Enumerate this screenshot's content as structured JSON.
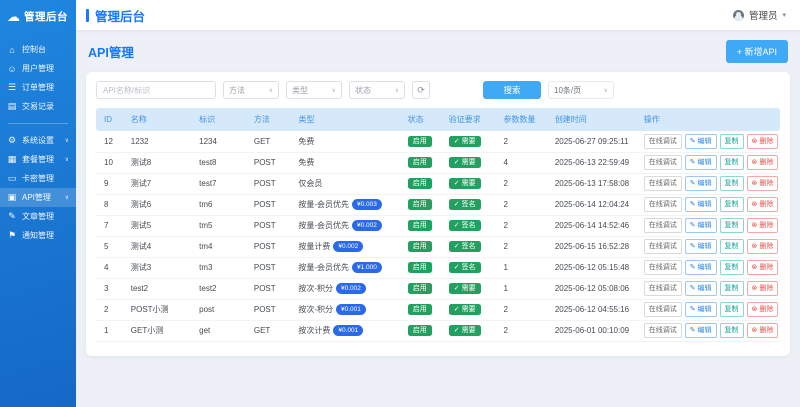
{
  "colors": {
    "sidebar_blue": "#1a78d6",
    "primary_blue": "#1677ff",
    "button_blue": "#40a9f5",
    "table_header_bg": "#d6e9fb",
    "table_header_text": "#4193e2",
    "badge_green": "#21a05f",
    "badge_price_blue": "#2a6ae8",
    "danger_red": "#e2504c"
  },
  "sidebar": {
    "logo": {
      "icon": "☁",
      "text": "管理后台"
    },
    "items": [
      {
        "key": "dashboard",
        "icon": "⌂",
        "label": "控制台",
        "chevron": false,
        "active": false,
        "divider_after": false
      },
      {
        "key": "users",
        "icon": "☺",
        "label": "用户管理",
        "chevron": false,
        "active": false,
        "divider_after": false
      },
      {
        "key": "orders",
        "icon": "☰",
        "label": "订单管理",
        "chevron": false,
        "active": false,
        "divider_after": false
      },
      {
        "key": "transactions",
        "icon": "▤",
        "label": "交易记录",
        "chevron": false,
        "active": false,
        "divider_after": true
      },
      {
        "key": "settings",
        "icon": "⚙",
        "label": "系统设置",
        "chevron": true,
        "active": false,
        "divider_after": false
      },
      {
        "key": "packages",
        "icon": "▦",
        "label": "套餐管理",
        "chevron": true,
        "active": false,
        "divider_after": false
      },
      {
        "key": "cards",
        "icon": "▭",
        "label": "卡密管理",
        "chevron": false,
        "active": false,
        "divider_after": false
      },
      {
        "key": "api",
        "icon": "▣",
        "label": "API管理",
        "chevron": true,
        "active": true,
        "divider_after": false
      },
      {
        "key": "articles",
        "icon": "✎",
        "label": "文章管理",
        "chevron": false,
        "active": false,
        "divider_after": false
      },
      {
        "key": "notifications",
        "icon": "⚑",
        "label": "通知管理",
        "chevron": false,
        "active": false,
        "divider_after": false
      }
    ]
  },
  "topbar": {
    "title": "管理后台",
    "user": "管理员",
    "caret": "▾"
  },
  "page": {
    "title": "API管理",
    "add_button": "+ 新增API"
  },
  "filters": {
    "search_placeholder": "API名称/标识",
    "selects": [
      "方法",
      "类型",
      "状态"
    ],
    "reset_icon": "⟳",
    "search_button": "搜索",
    "page_size": "10条/页",
    "chevron": "∨"
  },
  "table": {
    "headers": [
      "ID",
      "名称",
      "标识",
      "方法",
      "类型",
      "状态",
      "验证要求",
      "参数数量",
      "创建时间",
      "操作"
    ],
    "actions": [
      {
        "key": "debug",
        "label": "在线调试"
      },
      {
        "key": "edit",
        "label": "✎ 编辑"
      },
      {
        "key": "copy",
        "label": "复制"
      },
      {
        "key": "delete",
        "label": "⊗ 删除"
      }
    ],
    "rows": [
      {
        "id": "12",
        "name": "1232",
        "slug": "1234",
        "method": "GET",
        "type": "免费",
        "price": "",
        "status": "启用",
        "verify": "✓ 需要",
        "params": "2",
        "created": "2025-06-27 09:25:11"
      },
      {
        "id": "10",
        "name": "测试8",
        "slug": "test8",
        "method": "POST",
        "type": "免费",
        "price": "",
        "status": "启用",
        "verify": "✓ 需要",
        "params": "4",
        "created": "2025-06-13 22:59:49"
      },
      {
        "id": "9",
        "name": "测试7",
        "slug": "test7",
        "method": "POST",
        "type": "仅会员",
        "price": "",
        "status": "启用",
        "verify": "✓ 需要",
        "params": "2",
        "created": "2025-06-13 17:58:08"
      },
      {
        "id": "8",
        "name": "测试6",
        "slug": "tm6",
        "method": "POST",
        "type": "按量-会员优先",
        "price": "¥0.003",
        "status": "启用",
        "verify": "✓ 签名",
        "params": "2",
        "created": "2025-06-14 12:04:24"
      },
      {
        "id": "7",
        "name": "测试5",
        "slug": "tm5",
        "method": "POST",
        "type": "按量-会员优先",
        "price": "¥0.002",
        "status": "启用",
        "verify": "✓ 签名",
        "params": "2",
        "created": "2025-06-14 14:52:46"
      },
      {
        "id": "5",
        "name": "测试4",
        "slug": "tm4",
        "method": "POST",
        "type": "按量计费",
        "price": "¥0.002",
        "status": "启用",
        "verify": "✓ 签名",
        "params": "2",
        "created": "2025-06-15 16:52:28"
      },
      {
        "id": "4",
        "name": "测试3",
        "slug": "tm3",
        "method": "POST",
        "type": "按量-会员优先",
        "price": "¥1.000",
        "status": "启用",
        "verify": "✓ 签名",
        "params": "1",
        "created": "2025-06-12 05:15:48"
      },
      {
        "id": "3",
        "name": "test2",
        "slug": "test2",
        "method": "POST",
        "type": "按次-积分",
        "price": "¥0.002",
        "status": "启用",
        "verify": "✓ 需要",
        "params": "1",
        "created": "2025-06-12 05:08:06"
      },
      {
        "id": "2",
        "name": "POST小测",
        "slug": "post",
        "method": "POST",
        "type": "按次-积分",
        "price": "¥0.001",
        "status": "启用",
        "verify": "✓ 需要",
        "params": "2",
        "created": "2025-06-12 04:55:16"
      },
      {
        "id": "1",
        "name": "GET小测",
        "slug": "get",
        "method": "GET",
        "type": "按次计费",
        "price": "¥0.001",
        "status": "启用",
        "verify": "✓ 需要",
        "params": "2",
        "created": "2025-06-01 00:10:09"
      }
    ]
  }
}
